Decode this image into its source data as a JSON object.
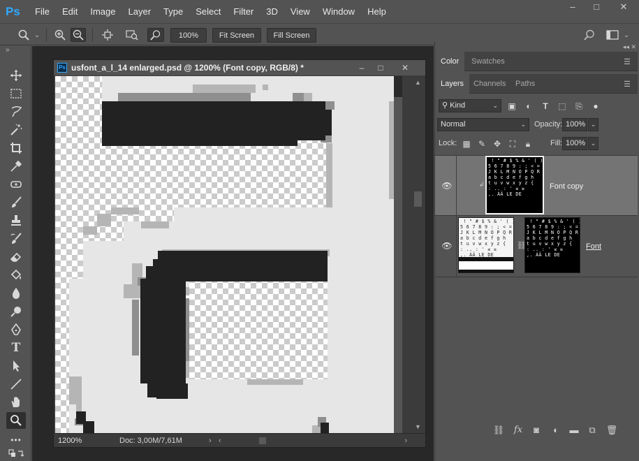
{
  "app": {
    "logo": "Ps",
    "menu": [
      "File",
      "Edit",
      "Image",
      "Layer",
      "Type",
      "Select",
      "Filter",
      "3D",
      "View",
      "Window",
      "Help"
    ],
    "window_controls": {
      "minimize": "–",
      "maximize": "□",
      "close": "✕"
    }
  },
  "options_bar": {
    "zoom_percent": "100%",
    "fit_screen": "Fit Screen",
    "fill_screen": "Fill Screen"
  },
  "toolbar": {
    "collapse": "»",
    "tools": [
      {
        "name": "move-tool",
        "icon": "move-icon"
      },
      {
        "name": "marquee-tool",
        "icon": "rect-marquee-icon"
      },
      {
        "name": "lasso-tool",
        "icon": "lasso-icon"
      },
      {
        "name": "quick-select-tool",
        "icon": "magic-wand-icon"
      },
      {
        "name": "crop-tool",
        "icon": "crop-icon"
      },
      {
        "name": "eyedropper-tool",
        "icon": "eyedropper-icon"
      },
      {
        "name": "healing-tool",
        "icon": "healing-brush-icon"
      },
      {
        "name": "brush-tool",
        "icon": "brush-icon"
      },
      {
        "name": "stamp-tool",
        "icon": "clone-stamp-icon"
      },
      {
        "name": "history-brush-tool",
        "icon": "history-brush-icon"
      },
      {
        "name": "eraser-tool",
        "icon": "eraser-icon"
      },
      {
        "name": "paint-bucket-tool",
        "icon": "paint-bucket-icon"
      },
      {
        "name": "blur-tool",
        "icon": "blur-icon"
      },
      {
        "name": "dodge-tool",
        "icon": "dodge-icon"
      },
      {
        "name": "pen-tool",
        "icon": "pen-icon"
      },
      {
        "name": "type-tool",
        "icon": "type-icon"
      },
      {
        "name": "path-select-tool",
        "icon": "path-select-icon"
      },
      {
        "name": "line-tool",
        "icon": "line-icon"
      },
      {
        "name": "hand-tool",
        "icon": "hand-icon"
      },
      {
        "name": "zoom-tool",
        "icon": "zoom-icon"
      },
      {
        "name": "more-tools",
        "icon": "more-icon"
      }
    ]
  },
  "document": {
    "title": "usfont_a_l_14 enlarged.psd @ 1200% (Font copy, RGB/8) *",
    "zoom": "1200%",
    "doc_size": "Doc: 3,00M/7,61M"
  },
  "panels": {
    "color_tabs": [
      "Color",
      "Swatches"
    ],
    "layer_tabs": [
      "Layers",
      "Channels",
      "Paths"
    ],
    "filter_kind": "Kind",
    "blend_mode": "Normal",
    "opacity_label": "Opacity:",
    "opacity": "100%",
    "lock_label": "Lock:",
    "fill_label": "Fill:",
    "fill": "100%",
    "layers": [
      {
        "name": "Font copy",
        "visible": true,
        "selected": true
      },
      {
        "name": "Font",
        "visible": true,
        "selected": false,
        "has_mask": true
      }
    ],
    "thumb_text": " ! \" # $ % & ' ( )\n5 6 7 8 9 : ; < =\nJ K L M N O P Q R S T\na b c d e f g h\nt u v w x y z {\n: .. : ' ≤ ≥\n,. ÀÄ LE DE"
  },
  "colors": {
    "accent": "#31a8ff",
    "ui_bg": "#535353",
    "workspace_bg": "#282828",
    "glyph_dark": "#222222",
    "glyph_light": "#e6e6e6"
  }
}
